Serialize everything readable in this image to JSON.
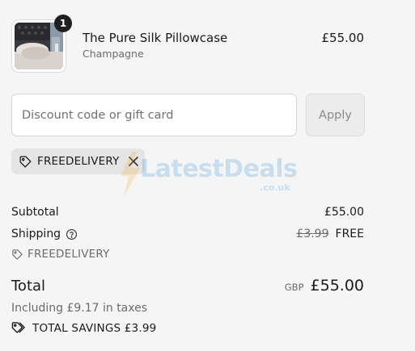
{
  "product": {
    "quantity": "1",
    "title": "The Pure Silk Pillowcase",
    "variant": "Champagne",
    "price": "£55.00"
  },
  "discount": {
    "placeholder": "Discount code or gift card",
    "value": "",
    "apply_label": "Apply",
    "applied_code": "FREEDELIVERY"
  },
  "watermark": {
    "text": "LatestDeals",
    "sub": ".co.uk"
  },
  "summary": {
    "subtotal_label": "Subtotal",
    "subtotal_value": "£55.00",
    "shipping_label": "Shipping",
    "shipping_old_price": "£3.99",
    "shipping_value": "FREE",
    "shipping_code": "FREEDELIVERY",
    "total_label": "Total",
    "total_currency": "GBP",
    "total_value": "£55.00",
    "taxes_text": "Including £9.17 in taxes",
    "savings_text": "TOTAL SAVINGS £3.99"
  },
  "icons": {
    "tag": "tag-icon",
    "close": "close-icon",
    "help": "help-circle-icon",
    "savings": "double-tag-icon"
  },
  "colors": {
    "background": "#f5f5f5",
    "chip": "#e4e4e4",
    "badge": "#1f1f1f",
    "muted_text": "#6b6b6b",
    "watermark": "#2d8fd6"
  }
}
